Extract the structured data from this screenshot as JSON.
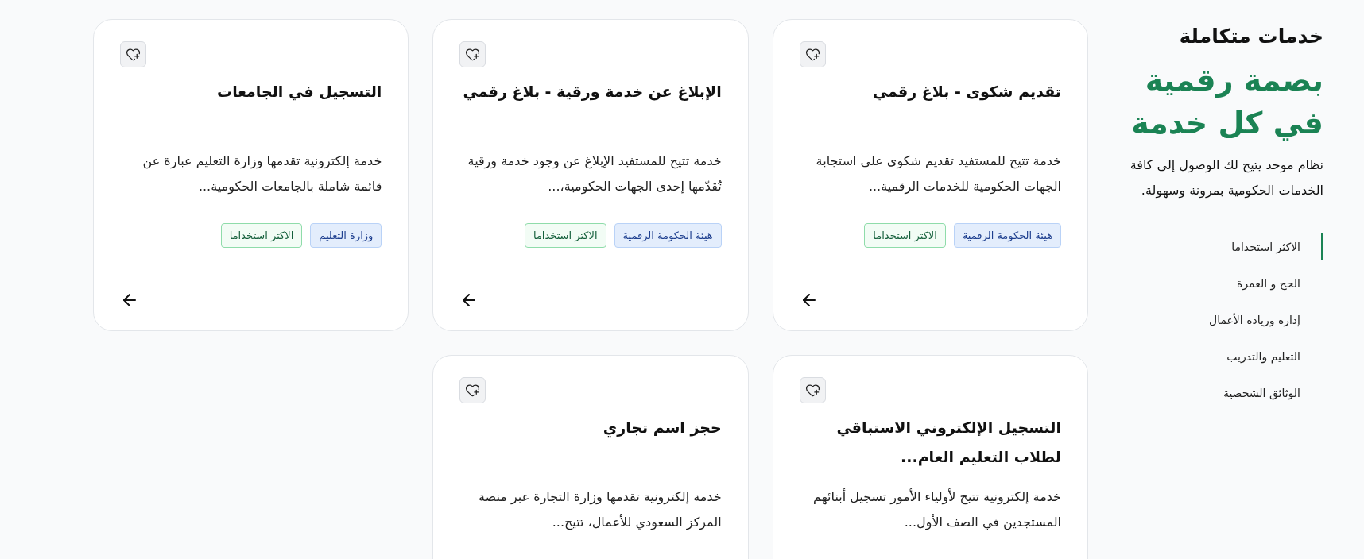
{
  "sidebar": {
    "eyebrow": "خدمات متكاملة",
    "headline": "بصمة رقمية في كل خدمة",
    "description": "نظام موحد يتيح لك الوصول إلى كافة الخدمات الحكومية بمرونة وسهولة.",
    "categories": [
      {
        "label": "الاكثر استخداما",
        "selected": true
      },
      {
        "label": "الحج و العمرة",
        "selected": false
      },
      {
        "label": "إدارة وريادة الأعمال",
        "selected": false
      },
      {
        "label": "التعليم والتدريب",
        "selected": false
      },
      {
        "label": "الوثائق الشخصية",
        "selected": false
      }
    ]
  },
  "cards": [
    {
      "title": "تقديم شكوى - بلاغ رقمي",
      "description": "خدمة تتيح للمستفيد تقديم شكوى على استجابة الجهات الحكومية للخدمات الرقمية...",
      "tags": [
        {
          "label": "هيئة الحكومة الرقمية",
          "kind": "agency"
        },
        {
          "label": "الاكثر استخداما",
          "kind": "usage"
        }
      ]
    },
    {
      "title": "الإبلاغ عن خدمة ورقية - بلاغ رقمي",
      "description": "خدمة تتيح للمستفيد الإبلاغ عن وجود خدمة ورقية تُقدّمها إحدى الجهات الحكومية،...",
      "tags": [
        {
          "label": "هيئة الحكومة الرقمية",
          "kind": "agency"
        },
        {
          "label": "الاكثر استخداما",
          "kind": "usage"
        }
      ]
    },
    {
      "title": "التسجيل في الجامعات",
      "description": "خدمة إلكترونية تقدمها وزارة التعليم عبارة عن قائمة شاملة بالجامعات الحكومية...",
      "tags": [
        {
          "label": "وزارة التعليم",
          "kind": "agency"
        },
        {
          "label": "الاكثر استخداما",
          "kind": "usage"
        }
      ]
    },
    {
      "title": "التسجيل الإلكتروني الاستباقي لطلاب التعليم العام...",
      "description": "خدمة إلكترونية تتيح لأولياء الأمور تسجيل أبنائهم المستجدين في الصف الأول..."
    },
    {
      "title": "حجز اسم تجاري",
      "description": "خدمة إلكترونية تقدمها وزارة التجارة عبر منصة المركز السعودي للأعمال، تتيح..."
    }
  ]
}
